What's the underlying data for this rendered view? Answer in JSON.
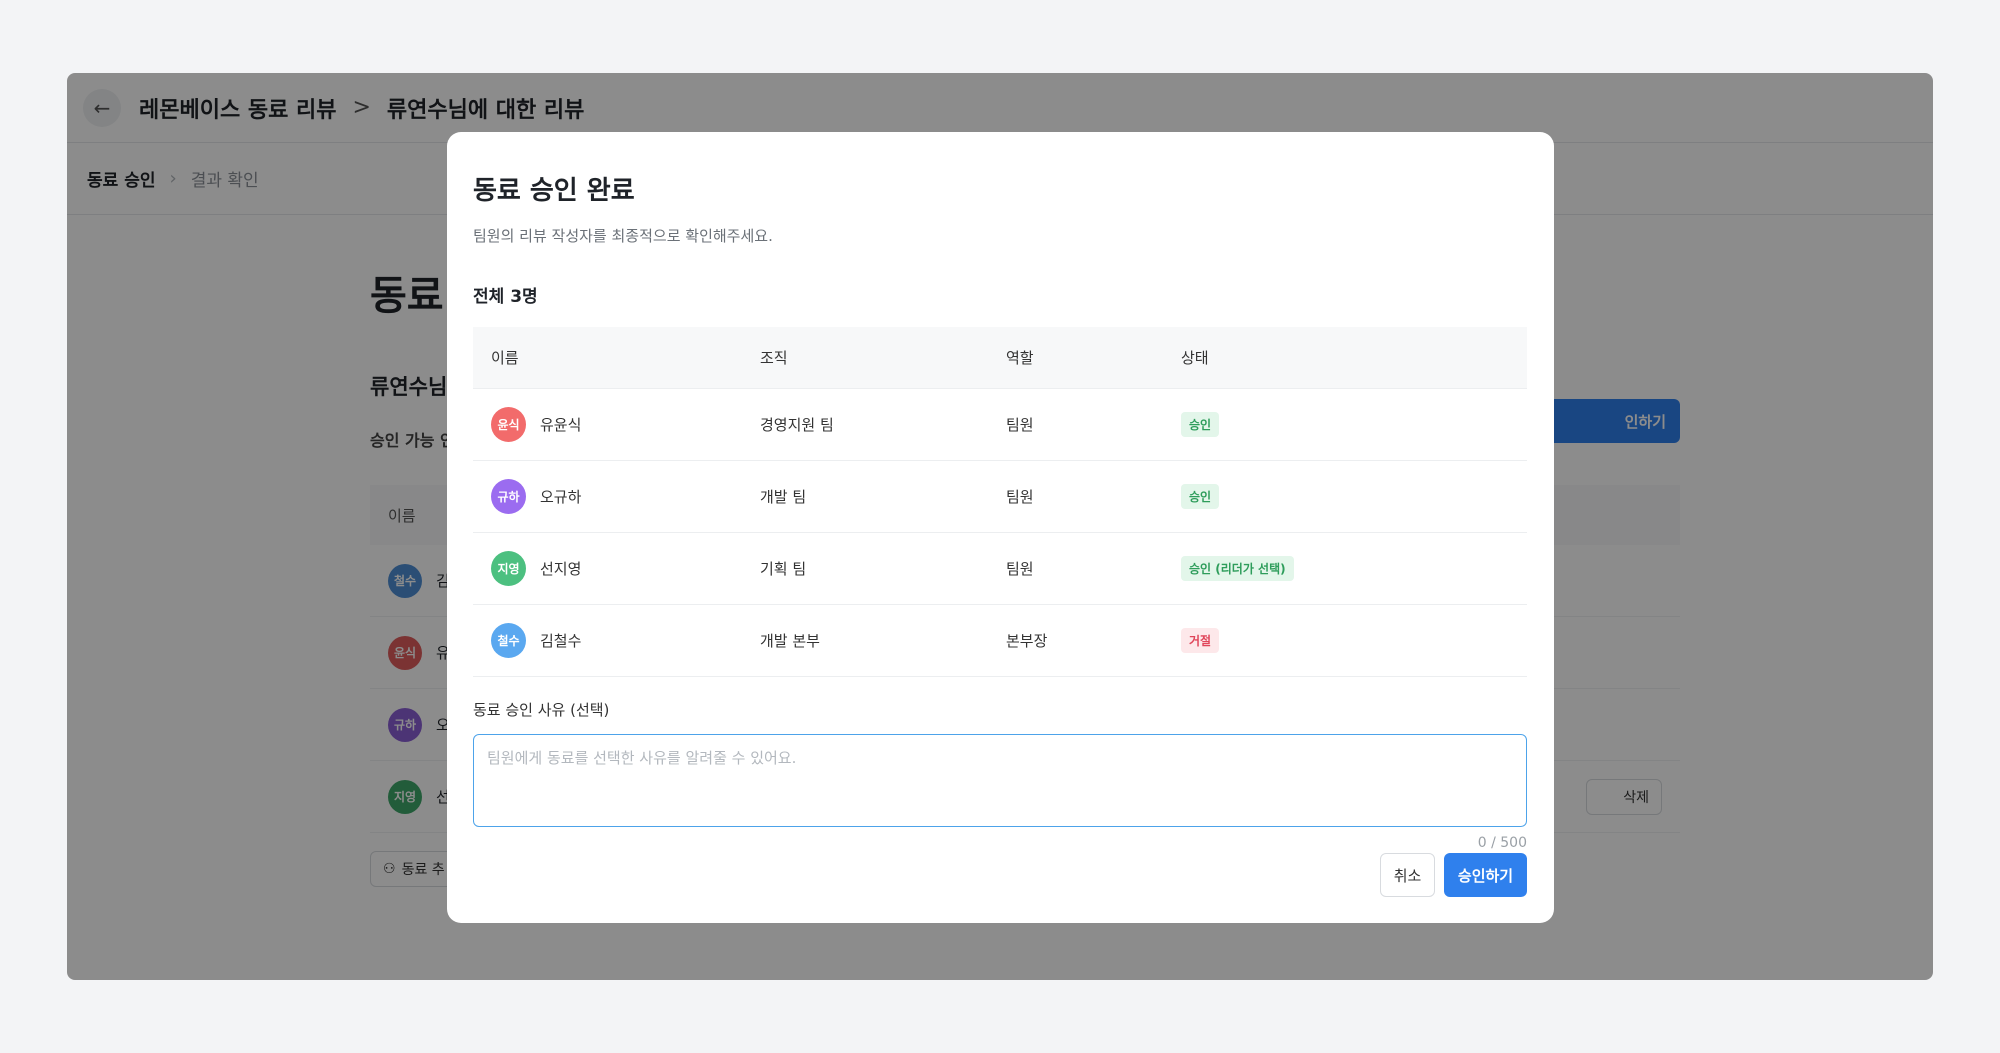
{
  "header": {
    "back_icon": "arrow-left-icon",
    "title": "레몬베이스 동료 리뷰",
    "separator": ">",
    "subtitle": "류연수님에 대한 리뷰"
  },
  "steps": {
    "active": "동료 승인",
    "next": "결과 확인"
  },
  "background": {
    "page_title": "동료",
    "section_title": "류연수님",
    "subtitle": "승인 가능 인",
    "approve_label": "인하기",
    "col_name": "이름",
    "rows": [
      {
        "initials": "철수",
        "name": "김",
        "color": "#4f8fd6"
      },
      {
        "initials": "윤식",
        "name": "유",
        "color": "#e05d5d"
      },
      {
        "initials": "규하",
        "name": "오",
        "color": "#8b5fd6"
      },
      {
        "initials": "지영",
        "name": "선",
        "color": "#3fa86b"
      }
    ],
    "delete_label": "삭제",
    "add_label": "동료 추"
  },
  "modal": {
    "title": "동료 승인 완료",
    "description": "팀원의 리뷰 작성자를 최종적으로 확인해주세요.",
    "count": "전체 3명",
    "columns": {
      "name": "이름",
      "org": "조직",
      "role": "역할",
      "status": "상태"
    },
    "rows": [
      {
        "initials": "윤식",
        "name": "유윤식",
        "org": "경영지원 팀",
        "role": "팀원",
        "status": "승인",
        "color": "#f26b6b",
        "status_type": "ok"
      },
      {
        "initials": "규하",
        "name": "오규하",
        "org": "개발 팀",
        "role": "팀원",
        "status": "승인",
        "color": "#9b6cf0",
        "status_type": "ok"
      },
      {
        "initials": "지영",
        "name": "선지영",
        "org": "기획 팀",
        "role": "팀원",
        "status": "승인 (리더가 선택)",
        "color": "#4cc080",
        "status_type": "ok"
      },
      {
        "initials": "철수",
        "name": "김철수",
        "org": "개발 본부",
        "role": "본부장",
        "status": "거절",
        "color": "#5aa8f0",
        "status_type": "no"
      }
    ],
    "reason_label": "동료 승인 사유 (선택)",
    "reason_value": "",
    "reason_placeholder": "팀원에게 동료를 선택한 사유를 알려줄 수 있어요.",
    "counter": "0 / 500",
    "cancel_label": "취소",
    "approve_label": "승인하기"
  },
  "colors": {
    "accent": "#2f80ed",
    "focus": "#4da3ea",
    "approved": "#2e9d5b",
    "rejected": "#e0455a"
  }
}
